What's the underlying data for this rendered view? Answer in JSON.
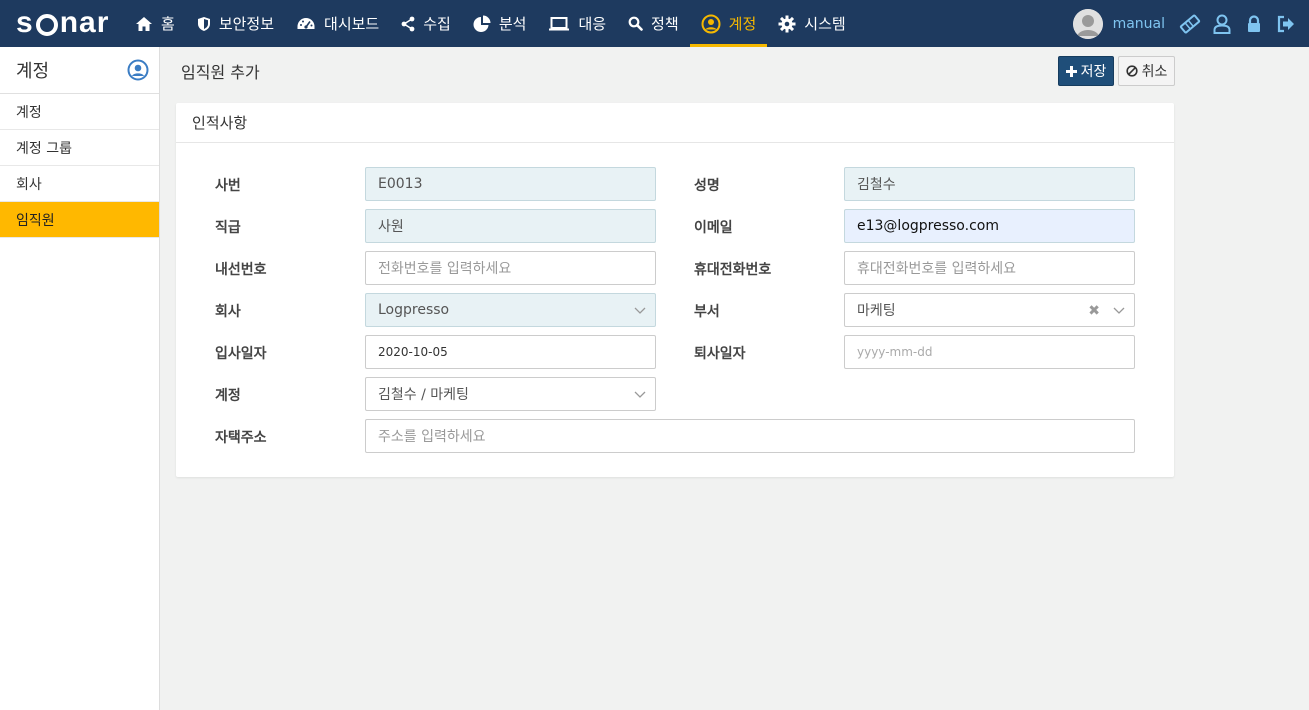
{
  "app": {
    "logo": "sonar"
  },
  "nav": [
    {
      "label": "홈",
      "icon": "home-icon"
    },
    {
      "label": "보안정보",
      "icon": "shield-icon"
    },
    {
      "label": "대시보드",
      "icon": "dashboard-icon"
    },
    {
      "label": "수집",
      "icon": "share-icon"
    },
    {
      "label": "분석",
      "icon": "pie-chart-icon"
    },
    {
      "label": "대응",
      "icon": "laptop-icon"
    },
    {
      "label": "정책",
      "icon": "search-icon"
    },
    {
      "label": "계정",
      "icon": "user-circle-icon",
      "active": true
    },
    {
      "label": "시스템",
      "icon": "gear-icon"
    }
  ],
  "user": {
    "name": "manual"
  },
  "colors": {
    "nav_bg": "#1e3a5f",
    "accent": "#f5b800",
    "primary": "#1f4e79",
    "sidebar_active": "#ffb800"
  },
  "sidebar": {
    "title": "계정",
    "items": [
      {
        "label": "계정"
      },
      {
        "label": "계정 그룹"
      },
      {
        "label": "회사"
      },
      {
        "label": "임직원",
        "active": true
      }
    ]
  },
  "page": {
    "title": "임직원 추가",
    "save_label": "저장",
    "cancel_label": "취소"
  },
  "form": {
    "section_title": "인적사항",
    "employee_id": {
      "label": "사번",
      "value": "E0013"
    },
    "name": {
      "label": "성명",
      "value": "김철수"
    },
    "position": {
      "label": "직급",
      "value": "사원"
    },
    "email": {
      "label": "이메일",
      "value": "e13@logpresso.com"
    },
    "extension": {
      "label": "내선번호",
      "placeholder": "전화번호를 입력하세요"
    },
    "mobile": {
      "label": "휴대전화번호",
      "placeholder": "휴대전화번호를 입력하세요"
    },
    "company": {
      "label": "회사",
      "value": "Logpresso"
    },
    "department": {
      "label": "부서",
      "value": "마케팅"
    },
    "hire_date": {
      "label": "입사일자",
      "value": "2020-10-05"
    },
    "leave_date": {
      "label": "퇴사일자",
      "placeholder": "yyyy-mm-dd"
    },
    "account": {
      "label": "계정",
      "value": "김철수 / 마케팅"
    },
    "address": {
      "label": "자택주소",
      "placeholder": "주소를 입력하세요"
    }
  }
}
